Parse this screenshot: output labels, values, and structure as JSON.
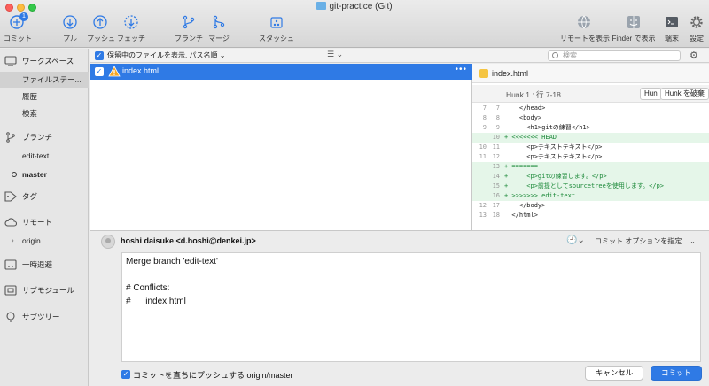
{
  "window": {
    "title": "git-practice (Git)",
    "traffic": {
      "close": "#fc605c",
      "minimize": "#fdbc40",
      "zoom": "#34c84a"
    }
  },
  "toolbar": {
    "commit": {
      "label": "コミット",
      "badge": "1",
      "icon": "commit-icon"
    },
    "pull": {
      "label": "プル",
      "icon": "pull-icon"
    },
    "push": {
      "label": "プッシュ",
      "icon": "push-icon"
    },
    "fetch": {
      "label": "フェッチ",
      "icon": "fetch-icon"
    },
    "branch": {
      "label": "ブランチ",
      "icon": "branch-icon"
    },
    "merge": {
      "label": "マージ",
      "icon": "merge-icon"
    },
    "stash": {
      "label": "スタッシュ",
      "icon": "stash-icon"
    },
    "remote_show": {
      "label": "リモートを表示",
      "icon": "globe-icon"
    },
    "finder_show": {
      "label": "Finder で表示",
      "icon": "finder-icon"
    },
    "terminal": {
      "label": "端末",
      "icon": "terminal-icon"
    },
    "settings": {
      "label": "設定",
      "icon": "gear-icon"
    }
  },
  "sidebar": {
    "workspace": "ワークスペース",
    "file_status": "ファイルステー...",
    "history": "履歴",
    "search": "検索",
    "branches": "ブランチ",
    "branch_edit_text": "edit-text",
    "branch_master": "master",
    "tags": "タグ",
    "remotes": "リモート",
    "remote_origin": "origin",
    "stashes": "一時退避",
    "submodules": "サブモジュール",
    "subtrees": "サブツリー"
  },
  "filebar": {
    "label": "保留中のファイルを表示, パス名順",
    "sort_symbol": "⌄",
    "search_placeholder": "検索"
  },
  "files": [
    {
      "name": "index.html",
      "status": "conflict"
    }
  ],
  "diff": {
    "file": "index.html",
    "hunk_title": "Hunk 1 : 行 7-18",
    "hunk_btn_1": "Hun",
    "hunk_btn_2": "Hunk を破棄",
    "lines": [
      {
        "o": "7",
        "n": "7",
        "t": "    </head>",
        "add": false
      },
      {
        "o": "8",
        "n": "8",
        "t": "    <body>",
        "add": false
      },
      {
        "o": "9",
        "n": "9",
        "t": "      <h1>gitの練習</h1>",
        "add": false
      },
      {
        "o": "",
        "n": "10",
        "t": "+ <<<<<<< HEAD",
        "add": true
      },
      {
        "o": "10",
        "n": "11",
        "t": "      <p>テキストテキスト</p>",
        "add": false
      },
      {
        "o": "11",
        "n": "12",
        "t": "      <p>テキストテキスト</p>",
        "add": false
      },
      {
        "o": "",
        "n": "13",
        "t": "+ =======",
        "add": true
      },
      {
        "o": "",
        "n": "14",
        "t": "+     <p>gitの練習します。</p>",
        "add": true
      },
      {
        "o": "",
        "n": "15",
        "t": "+     <p>前提としてsourcetreeを使用します。</p>",
        "add": true
      },
      {
        "o": "",
        "n": "16",
        "t": "+ >>>>>>> edit-text",
        "add": true
      },
      {
        "o": "12",
        "n": "17",
        "t": "    </body>",
        "add": false
      },
      {
        "o": "13",
        "n": "18",
        "t": "  </html>",
        "add": false
      }
    ]
  },
  "commit": {
    "author": "hoshi daisuke <d.hoshi@denkei.jp>",
    "options_label": "コミット オプションを指定... ⌄",
    "message": "Merge branch 'edit-text'\n\n# Conflicts:\n#\tindex.html",
    "push_label": "コミットを直ちにプッシュする origin/master",
    "cancel": "キャンセル",
    "submit": "コミット"
  }
}
